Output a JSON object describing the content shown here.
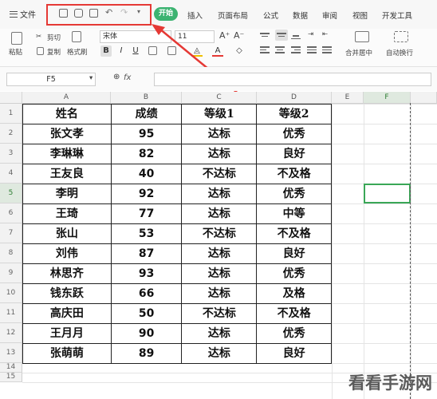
{
  "menu": {
    "file": "文件",
    "tabs": [
      "开始",
      "插入",
      "页面布局",
      "公式",
      "数据",
      "审阅",
      "视图",
      "开发工具"
    ]
  },
  "quick_access": {
    "icons": [
      "save-icon",
      "print-icon",
      "print-preview-icon",
      "undo-icon",
      "redo-icon",
      "more-icon"
    ]
  },
  "ribbon": {
    "cut": "剪切",
    "paste": "粘贴",
    "copy": "复制",
    "format_painter": "格式刷",
    "font_name": "宋体",
    "font_size": "11",
    "bold": "B",
    "italic": "I",
    "underline": "U",
    "merge_center": "合并居中",
    "wrap_text": "自动换行"
  },
  "formula_bar": {
    "name_box": "F5",
    "fx": "fx",
    "value": ""
  },
  "columns": [
    "A",
    "B",
    "C",
    "D",
    "E",
    "F"
  ],
  "rows": [
    "1",
    "2",
    "3",
    "4",
    "5",
    "6",
    "7",
    "8",
    "9",
    "10",
    "11",
    "12",
    "13",
    "14",
    "15"
  ],
  "table": {
    "headers": [
      "姓名",
      "成绩",
      "等级1",
      "等级2"
    ],
    "rows": [
      [
        "张文孝",
        "95",
        "达标",
        "优秀"
      ],
      [
        "李琳琳",
        "82",
        "达标",
        "良好"
      ],
      [
        "王友良",
        "40",
        "不达标",
        "不及格"
      ],
      [
        "李明",
        "92",
        "达标",
        "优秀"
      ],
      [
        "王琦",
        "77",
        "达标",
        "中等"
      ],
      [
        "张山",
        "53",
        "不达标",
        "不及格"
      ],
      [
        "刘伟",
        "87",
        "达标",
        "良好"
      ],
      [
        "林思齐",
        "93",
        "达标",
        "优秀"
      ],
      [
        "钱东跃",
        "66",
        "达标",
        "及格"
      ],
      [
        "高庆田",
        "50",
        "不达标",
        "不及格"
      ],
      [
        "王月月",
        "90",
        "达标",
        "优秀"
      ],
      [
        "张萌萌",
        "89",
        "达标",
        "良好"
      ]
    ]
  },
  "selected_cell": "F5",
  "watermark": "看看手游网",
  "colors": {
    "highlight_box": "#e53935",
    "start_tab": "#3cb371",
    "selection": "#3aa757"
  }
}
